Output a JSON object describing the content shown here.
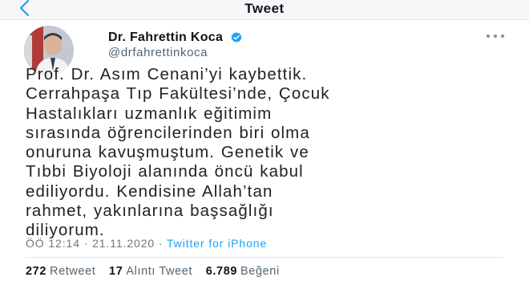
{
  "header": {
    "title": "Tweet"
  },
  "author": {
    "name": "Dr. Fahrettin Koca",
    "handle": "@drfahrettinkoca",
    "verified_color": "#1da1f2"
  },
  "tweet": {
    "lines": [
      "Prof. Dr. Asım Cenani’yi kaybettik.",
      "Cerrahpaşa Tıp Fakültesi’nde, Çocuk",
      "Hastalıkları uzmanlık eğitimim",
      "sırasında öğrencilerinden biri olma",
      "onuruna kavuşmuştum. Genetik ve",
      "Tıbbi Biyoloji alanında öncü kabul",
      "ediliyordu. Kendisine Allah’tan",
      "rahmet, yakınlarına başsağlığı",
      "diliyorum."
    ],
    "time": "ÖÖ 12:14",
    "date": "21.11.2020",
    "separator": "·",
    "source": "Twitter for iPhone"
  },
  "stats": {
    "retweets_count": "272",
    "retweets_label": "Retweet",
    "quotes_count": "17",
    "quotes_label": "Alıntı Tweet",
    "likes_count": "6.789",
    "likes_label": "Beğeni"
  },
  "icons": {
    "back": "chevron-left-icon",
    "verified": "verified-badge-icon",
    "more": "more-options-icon"
  }
}
